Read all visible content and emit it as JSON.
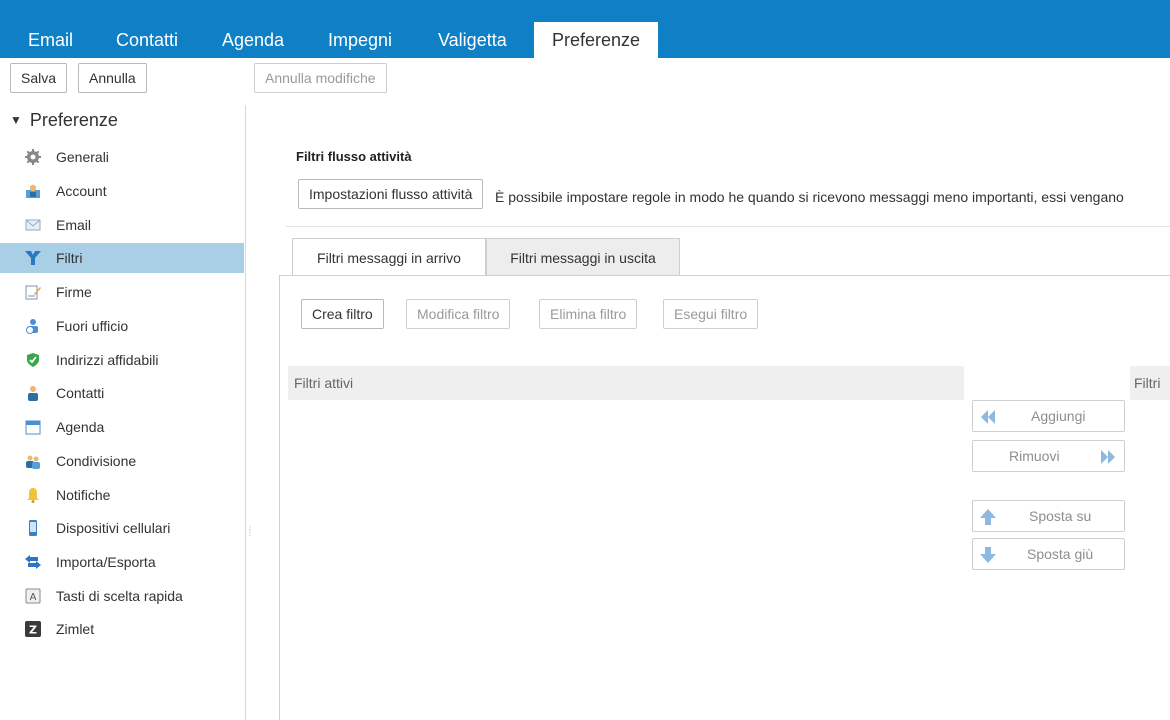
{
  "app_tabs": [
    "Email",
    "Contatti",
    "Agenda",
    "Impegni",
    "Valigetta",
    "Preferenze"
  ],
  "toolbar": {
    "save_label": "Salva",
    "cancel_label": "Annulla",
    "undo_label": "Annulla modifiche"
  },
  "sidebar": {
    "root_label": "Preferenze",
    "items": [
      {
        "label": "Generali",
        "icon": "gear-icon"
      },
      {
        "label": "Account",
        "icon": "account-icon"
      },
      {
        "label": "Email",
        "icon": "envelope-icon"
      },
      {
        "label": "Filtri",
        "icon": "filter-icon"
      },
      {
        "label": "Firme",
        "icon": "signature-icon"
      },
      {
        "label": "Fuori ufficio",
        "icon": "out-of-office-icon"
      },
      {
        "label": "Indirizzi affidabili",
        "icon": "shield-check-icon"
      },
      {
        "label": "Contatti",
        "icon": "contact-icon"
      },
      {
        "label": "Agenda",
        "icon": "calendar-icon"
      },
      {
        "label": "Condivisione",
        "icon": "sharing-icon"
      },
      {
        "label": "Notifiche",
        "icon": "bell-icon"
      },
      {
        "label": "Dispositivi cellulari",
        "icon": "mobile-icon"
      },
      {
        "label": "Importa/Esporta",
        "icon": "import-export-icon"
      },
      {
        "label": "Tasti di scelta rapida",
        "icon": "keyboard-icon"
      },
      {
        "label": "Zimlet",
        "icon": "zimlet-icon"
      }
    ],
    "selected": "Filtri"
  },
  "activity": {
    "title": "Filtri flusso attività",
    "button_label": "Impostazioni flusso attività",
    "description": "È possibile impostare regole in modo he quando si ricevono messaggi meno importanti, essi vengano"
  },
  "tabs": {
    "incoming": "Filtri messaggi in arrivo",
    "outgoing": "Filtri messaggi in uscita"
  },
  "filter_actions": {
    "create": "Crea filtro",
    "edit": "Modifica filtro",
    "delete": "Elimina filtro",
    "run": "Esegui filtro"
  },
  "lists": {
    "active_header": "Filtri attivi",
    "inactive_header": "Filtri"
  },
  "move_buttons": {
    "add": "Aggiungi",
    "remove": "Rimuovi",
    "up": "Sposta su",
    "down": "Sposta giù"
  },
  "colors": {
    "topbar": "#0f80c6",
    "selected_row": "#a9cfe6"
  }
}
